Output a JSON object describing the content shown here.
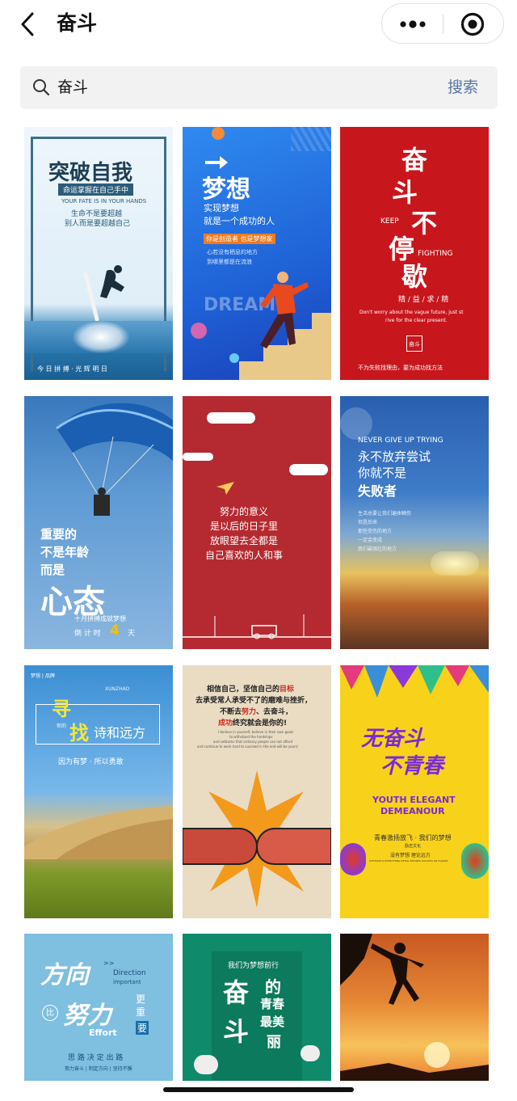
{
  "header": {
    "title": "奋斗"
  },
  "search": {
    "value": "奋斗",
    "button": "搜索"
  },
  "cards": [
    {
      "bg_top": "#eaf4fb",
      "bg_bottom": "#1d6fa5",
      "title": "突破自我",
      "line1": "命运掌握在自己手中",
      "line2": "YOUR FATE IS IN YOUR HANDS",
      "line3": "生命不是要超越",
      "line4": "别人而是要超越自己",
      "footer": "今 日 拼 搏 · 光 辉 明 日"
    },
    {
      "bg_top": "#2a7fe0",
      "bg_bottom": "#1a4ec0",
      "title": "梦想",
      "line1": "实现梦想",
      "line2": "就是一个成功的人",
      "line3": "你是创造者 也是梦想家",
      "line4": "心若没有栖息的地方",
      "line5": "到哪里都是在流浪",
      "deco": "DREAM"
    },
    {
      "bg": "#c8161d",
      "title1": "奋",
      "title2": "斗",
      "title3": "不",
      "title4": "停",
      "title5": "歇",
      "keep": "KEEP",
      "fighting": "FIGHTING",
      "motto": "精 / 益 / 求 / 精",
      "en1": "Don't worry about the vague future, just st",
      "en2": "rive for the clear present.",
      "seal": "奋斗",
      "footer": "不为失败找理由，要为成功找方法"
    },
    {
      "bg_top": "#6aa0d6",
      "bg_bottom": "#1e4f90",
      "line1": "重要的",
      "line2": "不是年龄",
      "line3": "而是",
      "big": "心态",
      "sub": "十月拼搏成就梦想",
      "countdown": "倒 计 时",
      "days": "4",
      "unit": "天"
    },
    {
      "bg": "#b52a30",
      "line1": "努力的意义",
      "line2": "是以后的日子里",
      "line3": "放眼望去全都是",
      "line4": "自己喜欢的人和事"
    },
    {
      "bg_top": "#2a5fb0",
      "bg_bottom": "#c26a2a",
      "en": "NEVER GIVE UP TRYING",
      "line1": "永不放弃尝试",
      "line2": "你就不是",
      "line3": "失败者",
      "p1": "生活总要让我们遍体鳞伤",
      "p2": "但是后来",
      "p3": "那些受伤的地方",
      "p4": "一定会变成",
      "p5": "我们最强壮的地方"
    },
    {
      "bg_top": "#3b8ed4",
      "bg_bottom": "#8aa832",
      "brand": "梦想 | 品牌",
      "title1": "寻",
      "title2": "找",
      "title3": "诗和远方",
      "sub": "因为有梦 · 所以勇敢",
      "small": "你的",
      "en": "XUNZHAO"
    },
    {
      "bg": "#e9dcc3",
      "line1": "相信自己，坚信自己的",
      "hl1": "目标",
      "line2": "去承受常人承受不了的磨难与挫折，",
      "line3": "不断去",
      "hl2": "努力",
      "line3b": "、去奋斗，",
      "line4": "成功",
      "line4b": "终究就会是你的!",
      "en1": "I believe in yourself, believe in their own goals",
      "en2": "to withstand the hardships",
      "en3": "and setbacks that ordinary people can not afford",
      "en4": "and continue to work hard to succeed in the end will be yours!"
    },
    {
      "bg": "#f8d21a",
      "title1": "无奋斗",
      "title2": "不青春",
      "en1": "YOUTH ELEGANT",
      "en2": "DEMEANOUR",
      "sub": "青春激扬放飞 · 我们的梦想",
      "small1": "励志文化",
      "small2": "没有梦想   理论远方",
      "small3": "ATTITUDE IS EVERYTHING DETAIL DECIDES SUCCESS OR FAILURE"
    },
    {
      "bg": "#7fbfe0",
      "t1": "方向",
      "t2": "比",
      "t3": "努力",
      "t4": "更",
      "t5": "重",
      "t6": "要",
      "en1": "Direction",
      "en2": "important",
      "en3": "Effort",
      "arrow": ">>",
      "footer": "思 路 决 定 出 路",
      "small": "努力奋斗 | 制定方向 | 坚持不懈"
    },
    {
      "bg": "#0f8a6a",
      "top": "我们为梦想前行",
      "t1": "奋",
      "t2": "斗",
      "t3": "的",
      "t4": "青春",
      "t5": "最美",
      "t6": "丽"
    },
    {
      "bg_top": "#d9702a",
      "bg_bottom": "#f5b247"
    }
  ],
  "colors": {
    "accent": "#5a74a8",
    "icon": "#111111"
  }
}
